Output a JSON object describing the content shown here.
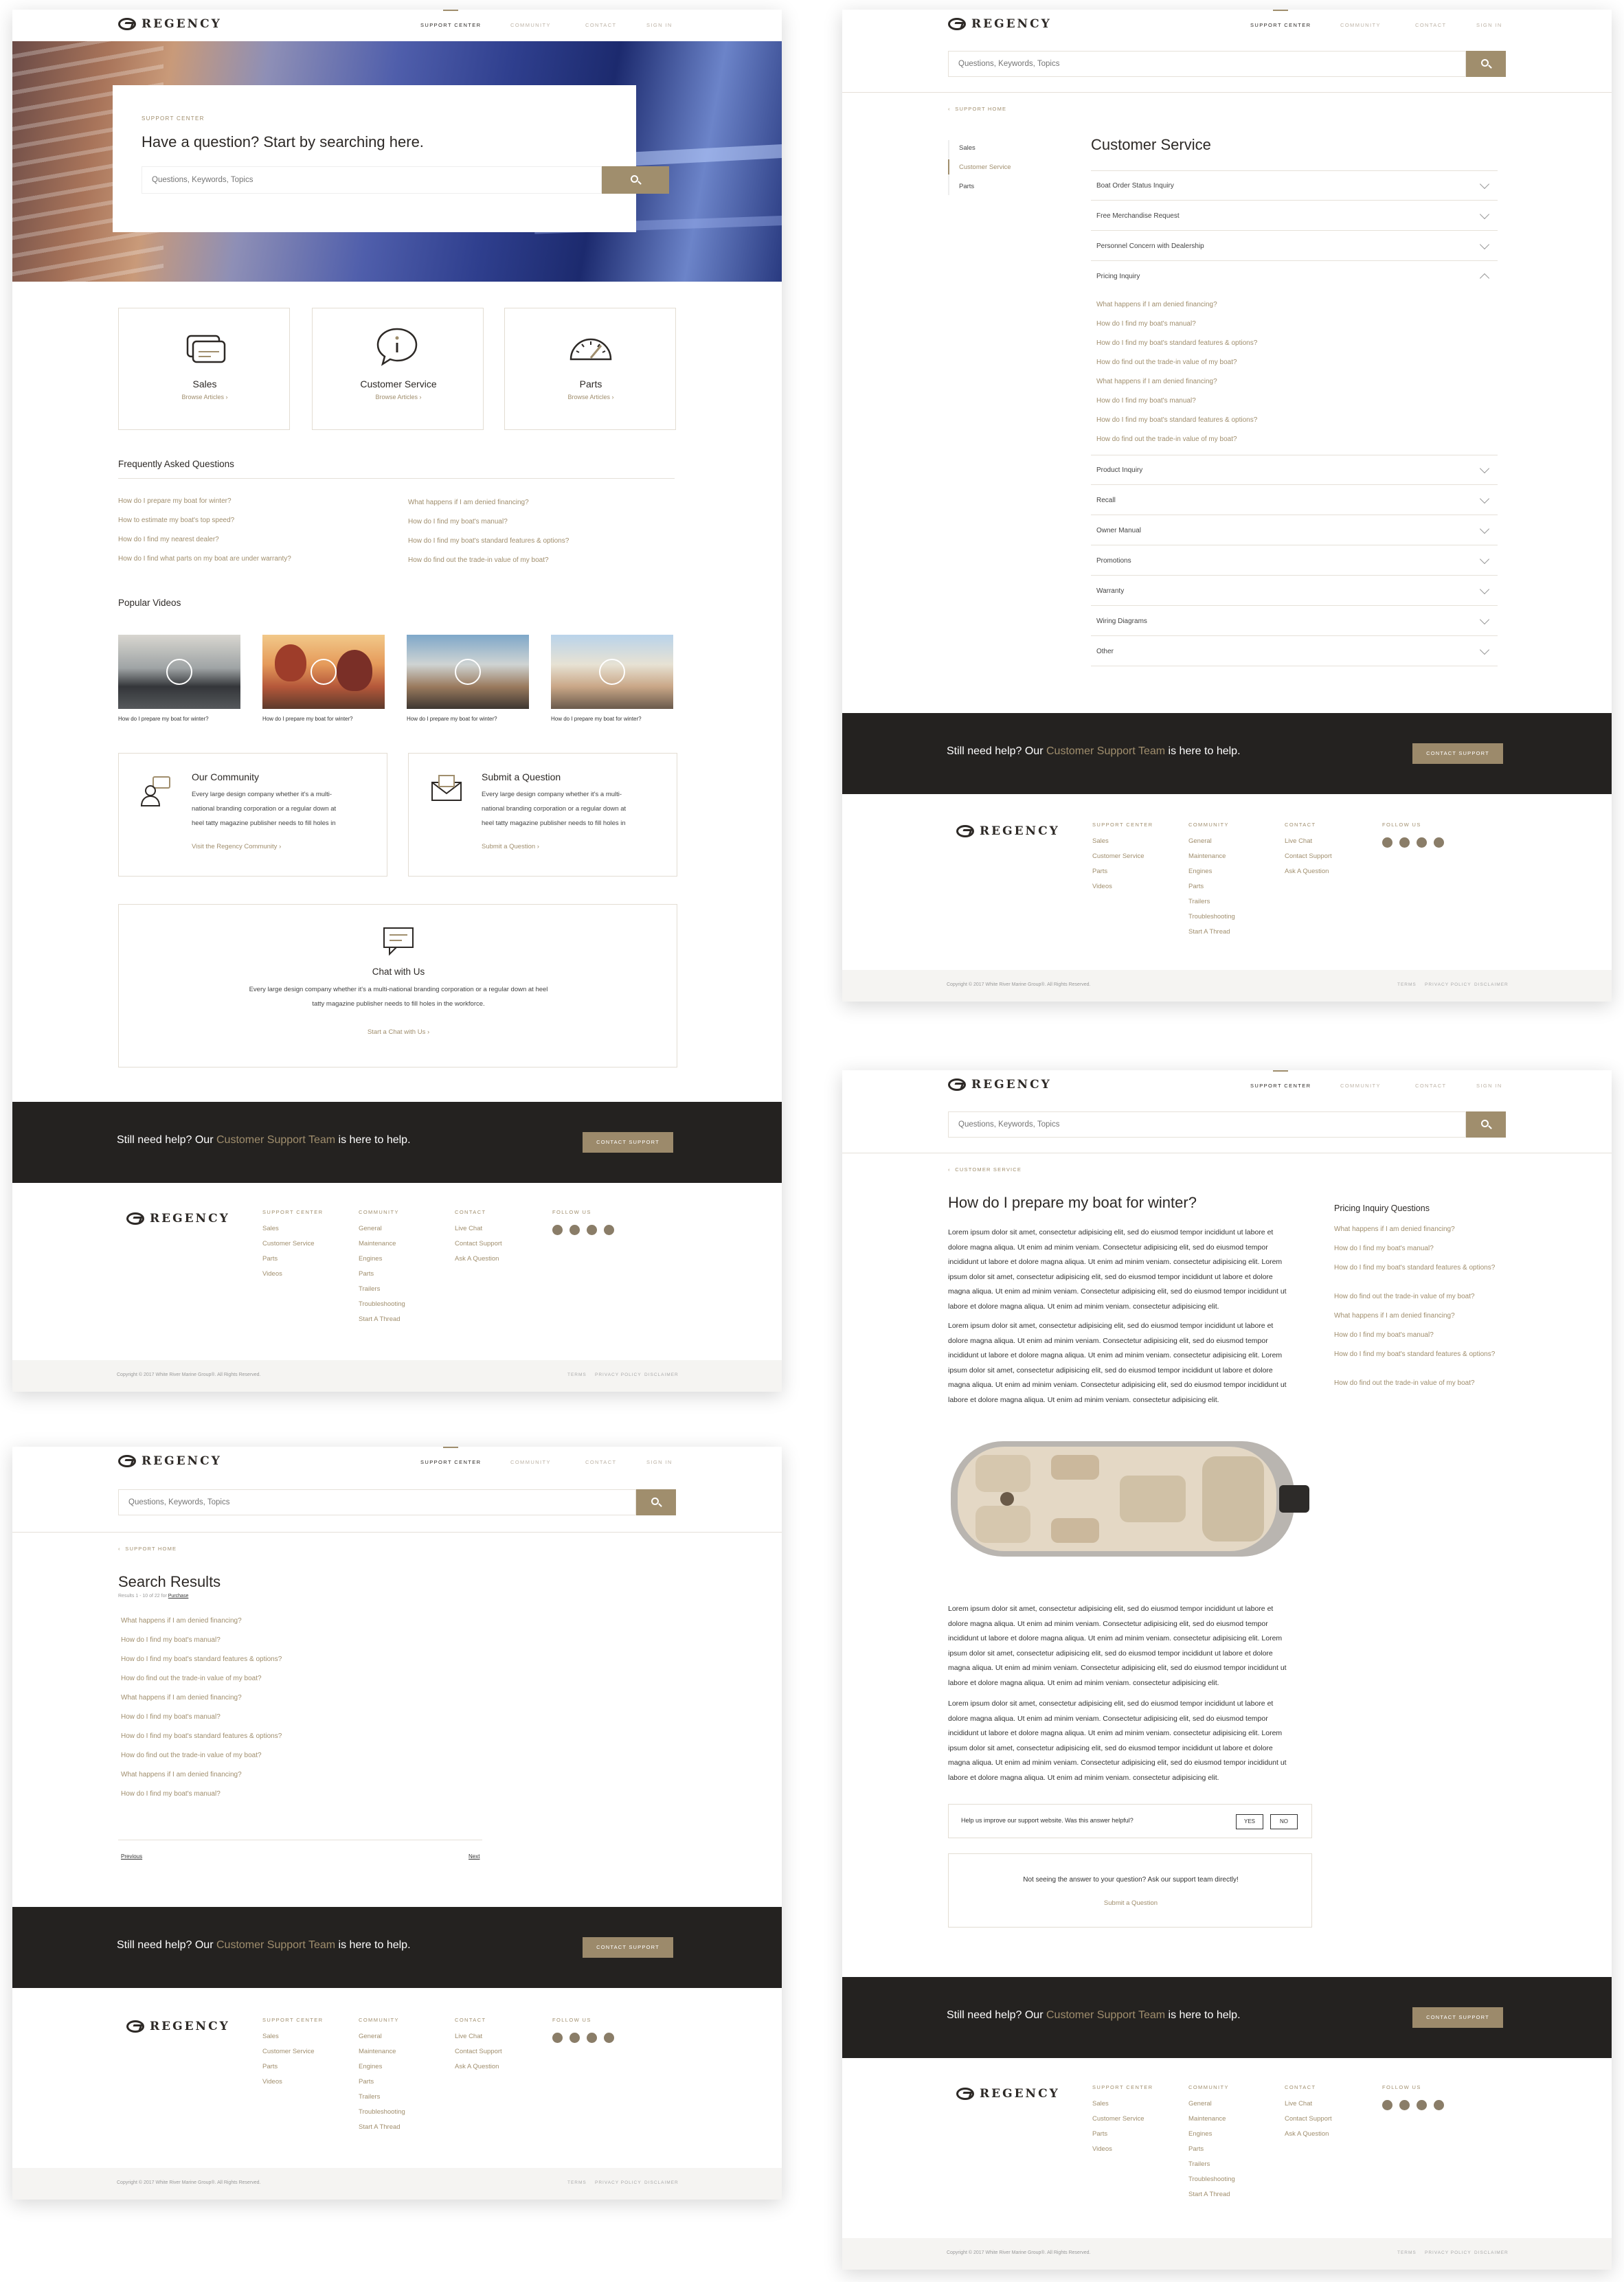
{
  "brand": {
    "name": "REGENCY"
  },
  "colors": {
    "accent": "#a08e6d",
    "dark": "#242220",
    "border": "#e3ddd3"
  },
  "nav": {
    "support": "SUPPORT CENTER",
    "community": "COMMUNITY",
    "contact": "CONTACT",
    "signin": "SIGN IN"
  },
  "search": {
    "placeholder": "Questions, Keywords, Topics",
    "icon": "search-icon"
  },
  "home": {
    "hero_eyebrow": "SUPPORT CENTER",
    "hero_title": "Have a question? Start by searching here.",
    "categories": [
      {
        "title": "Sales",
        "link": "Browse Articles",
        "icon": "cash-icon"
      },
      {
        "title": "Customer Service",
        "link": "Browse Articles",
        "icon": "info-bubble-icon"
      },
      {
        "title": "Parts",
        "link": "Browse Articles",
        "icon": "gauge-icon"
      }
    ],
    "faq_title": "Frequently Asked Questions",
    "faq_left": [
      "How do I prepare my boat for winter?",
      "How to estimate my boat's top speed?",
      "How do I find my nearest dealer?",
      "How do I find what parts on my boat are under warranty?"
    ],
    "faq_right": [
      "What happens if I am denied financing?",
      "How do I find my boat's manual?",
      "How do I find my boat's standard features & options?",
      "How do find out the trade-in value of my boat?"
    ],
    "videos_title": "Popular Videos",
    "videos": [
      "How do I prepare my boat for winter?",
      "How do I prepare my boat for winter?",
      "How do I prepare my boat for winter?",
      "How do I prepare my boat for winter?"
    ],
    "community": {
      "title": "Our Community",
      "body": [
        "Every large design company whether it's a multi-",
        "national branding corporation or a regular down at",
        "heel tatty magazine publisher needs to fill holes in"
      ],
      "link": "Visit the Regency Community"
    },
    "submit": {
      "title": "Submit a Question",
      "body": [
        "Every large design company whether it's a multi-",
        "national branding corporation or a regular down at",
        "heel tatty magazine publisher needs to fill holes in"
      ],
      "link": "Submit a Question"
    },
    "chat": {
      "title": "Chat with Us",
      "body": [
        "Every large design company whether it's a multi-national branding corporation or a regular down at heel",
        "tatty magazine publisher needs to fill holes in the workforce."
      ],
      "link": "Start a Chat with Us"
    }
  },
  "support_footer": {
    "pre": "Still need help? Our ",
    "team": "Customer Support Team",
    "post": " is here to help.",
    "button": "CONTACT SUPPORT"
  },
  "footer": {
    "cols": [
      {
        "head": "SUPPORT CENTER",
        "items": [
          "Sales",
          "Customer Service",
          "Parts",
          "Videos"
        ]
      },
      {
        "head": "COMMUNITY",
        "items": [
          "General",
          "Maintenance",
          "Engines",
          "Parts",
          "Trailers",
          "Troubleshooting",
          "Start A Thread"
        ]
      },
      {
        "head": "CONTACT",
        "items": [
          "Live Chat",
          "Contact Support",
          "Ask A Question"
        ]
      }
    ],
    "follow": "FOLLOW US",
    "copyright": "Copyright © 2017 White River Marine Group®. All Rights Reserved.",
    "terms": "TERMS",
    "privacy": "PRIVACY POLICY",
    "disclaimer": "DISCLAIMER"
  },
  "category_page": {
    "breadcrumb": "SUPPORT HOME",
    "sidenav": [
      "Sales",
      "Customer Service",
      "Parts"
    ],
    "title": "Customer Service",
    "acc_top": [
      "Boat Order Status Inquiry",
      "Free Merchandise Request",
      "Personnel Concern with Dealership",
      "Pricing Inquiry"
    ],
    "expanded": [
      "What happens if I am denied financing?",
      "How do I find my boat's manual?",
      "How do I find my boat's standard features & options?",
      "How do find out the trade-in value of my boat?",
      "What happens if I am denied financing?",
      "How do I find my boat's manual?",
      "How do I find my boat's standard features & options?",
      "How do find out the trade-in value of my boat?"
    ],
    "acc_bottom": [
      "Product Inquiry",
      "Recall",
      "Owner Manual",
      "Promotions",
      "Warranty",
      "Wiring Diagrams",
      "Other"
    ]
  },
  "results_page": {
    "breadcrumb": "SUPPORT HOME",
    "title": "Search Results",
    "count": "Results 1 - 10 of 22 for ",
    "term": "Purchase",
    "results": [
      "What happens if I am denied financing?",
      "How do I find my boat's manual?",
      "How do I find my boat's standard features & options?",
      "How do find out the trade-in value of my boat?",
      "What happens if I am denied financing?",
      "How do I find my boat's manual?",
      "How do I find my boat's standard features & options?",
      "How do find out the trade-in value of my boat?",
      "What happens if I am denied financing?",
      "How do I find my boat's manual?"
    ],
    "prev": "Previous",
    "next": "Next"
  },
  "article_page": {
    "breadcrumb": "CUSTOMER SERVICE",
    "title": "How do I prepare my boat for winter?",
    "para_lines": [
      "Lorem ipsum dolor sit amet, consectetur adipisicing elit, sed do eiusmod tempor incididunt ut labore et",
      "dolore magna aliqua. Ut enim ad minim veniam. Consectetur adipisicing elit, sed do eiusmod tempor",
      "incididunt ut labore et dolore magna aliqua. Ut enim ad minim veniam. consectetur adipisicing elit. Lorem",
      "ipsum dolor sit amet, consectetur adipisicing elit, sed do eiusmod tempor incididunt ut labore et dolore",
      "magna aliqua. Ut enim ad minim veniam. Consectetur adipisicing elit, sed do eiusmod tempor incididunt ut",
      "labore et dolore magna aliqua. Ut enim ad minim veniam. consectetur adipisicing elit."
    ],
    "sidebar_title": "Pricing Inquiry Questions",
    "sidebar": [
      "What happens if I am denied financing?",
      "How do I find my boat's manual?",
      "How do I find my boat's standard features & options?",
      "How do find out the trade-in value of my boat?",
      "What happens if I am denied financing?",
      "How do I find my boat's manual?",
      "How do I find my boat's standard features & options?",
      "How do find out the trade-in value of my boat?"
    ],
    "helpful": "Help us improve our support website. Was this answer helpful?",
    "yes": "YES",
    "no": "NO",
    "notseeing": "Not seeing the answer to your question? Ask our support team directly!",
    "submit": "Submit a Question"
  }
}
